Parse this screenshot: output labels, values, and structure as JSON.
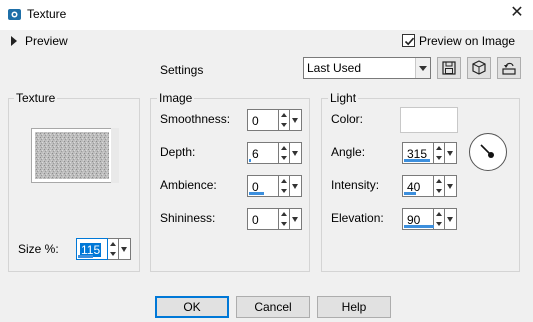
{
  "window": {
    "title": "Texture",
    "close_glyph": "✕"
  },
  "preview": {
    "toggle_label": "Preview",
    "checkbox_label": "Preview on Image",
    "checkbox_checked": true
  },
  "settings": {
    "label": "Settings",
    "preset_value": "Last Used"
  },
  "texture_group": {
    "title": "Texture",
    "size_label": "Size %:",
    "size_value": "115",
    "size_fill_fraction": 0.5
  },
  "image_group": {
    "title": "Image",
    "fields": [
      {
        "label": "Smoothness:",
        "value": "0",
        "fill_fraction": 0.0
      },
      {
        "label": "Depth:",
        "value": "6",
        "fill_fraction": 0.06
      },
      {
        "label": "Ambience:",
        "value": "0",
        "fill_fraction": 0.5
      },
      {
        "label": "Shininess:",
        "value": "0",
        "fill_fraction": 0.0
      }
    ]
  },
  "light_group": {
    "title": "Light",
    "color_label": "Color:",
    "color_value": "#ffffff",
    "fields": [
      {
        "label": "Angle:",
        "value": "315",
        "fill_fraction": 0.875
      },
      {
        "label": "Intensity:",
        "value": "40",
        "fill_fraction": 0.4
      },
      {
        "label": "Elevation:",
        "value": "90",
        "fill_fraction": 1.0
      }
    ]
  },
  "buttons": {
    "ok": "OK",
    "cancel": "Cancel",
    "help": "Help"
  },
  "colors": {
    "accent": "#3c8fdd",
    "focus": "#0078d7",
    "app_icon": "#1e6fa8"
  }
}
